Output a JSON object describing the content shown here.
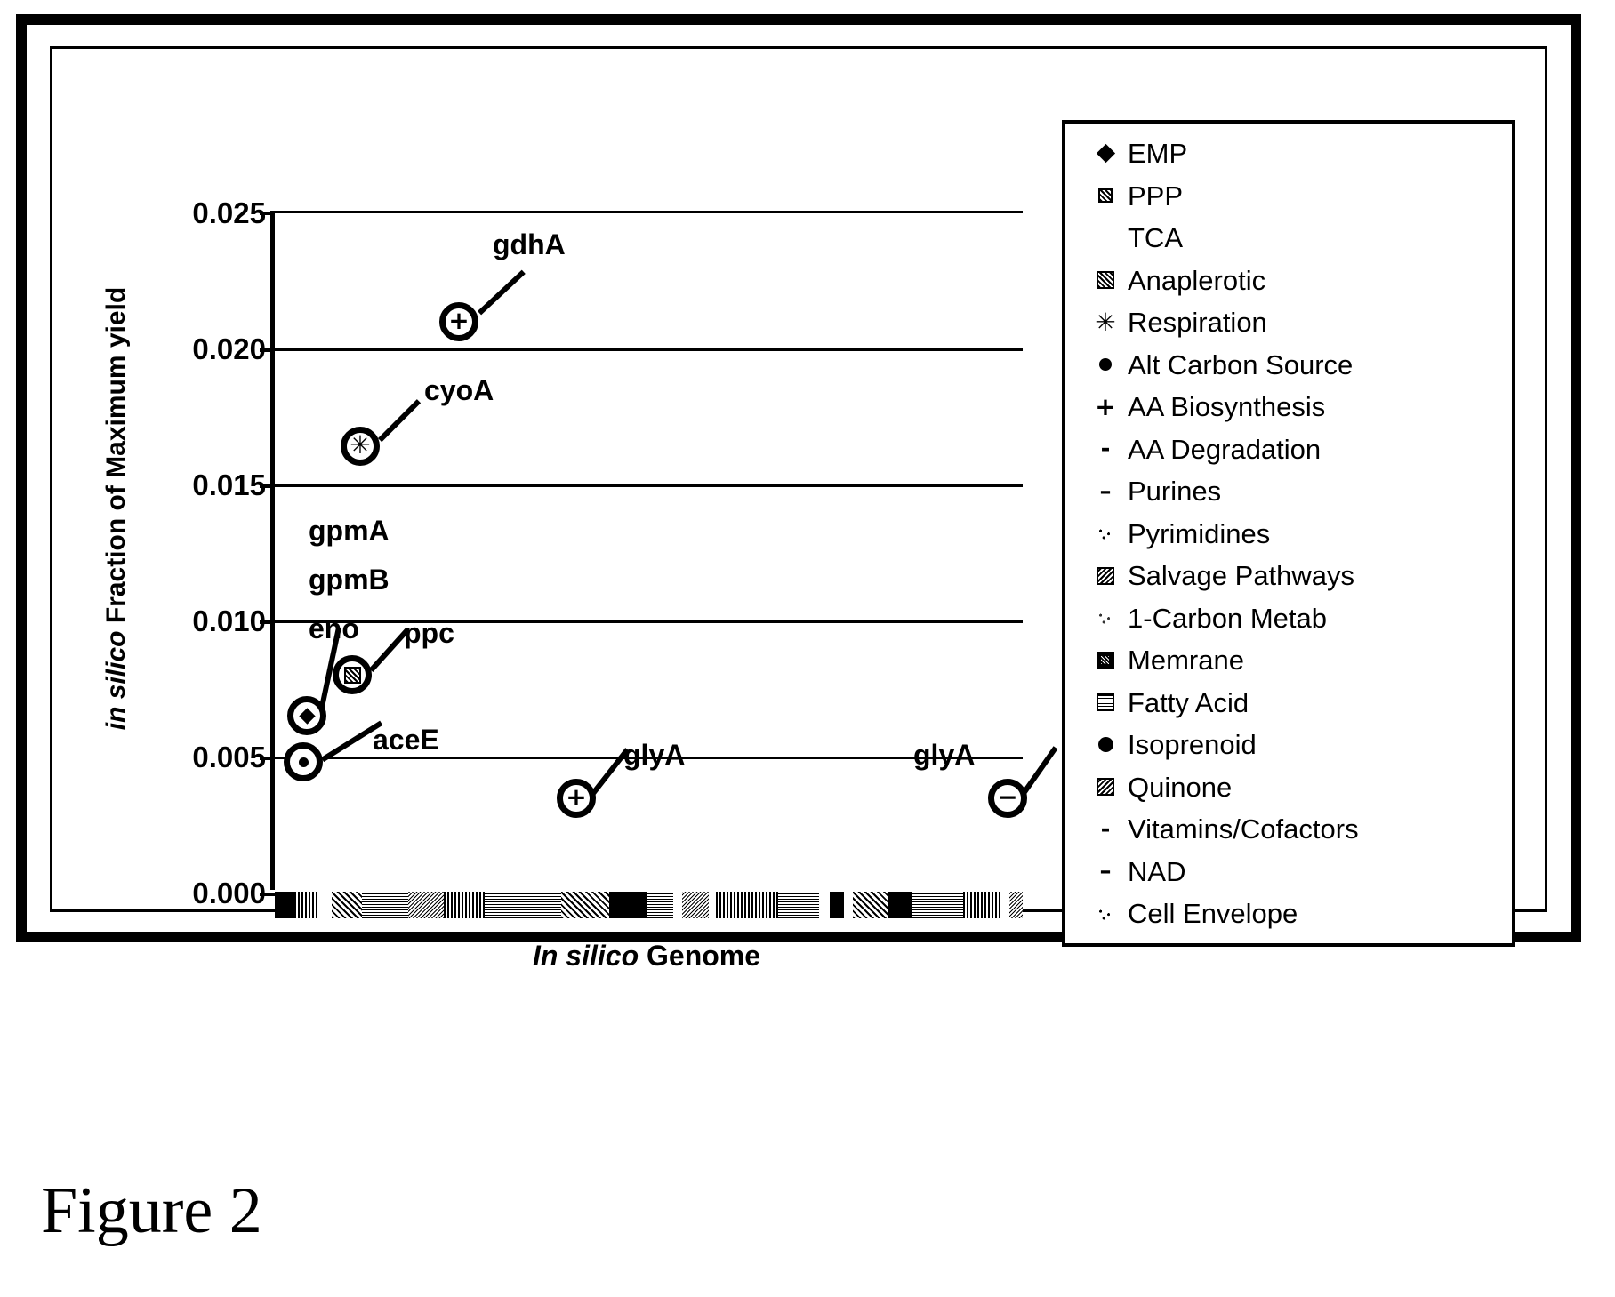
{
  "figure": {
    "caption": "Figure 2"
  },
  "chart_data": {
    "type": "scatter",
    "title": "",
    "xlabel_italic": "In silico",
    "xlabel_rest": " Genome",
    "ylabel_italic": "in silico",
    "ylabel_rest": " Fraction of Maximum yield",
    "ylim": [
      0.0,
      0.025
    ],
    "ytick_labels": [
      "0.025",
      "0.020",
      "0.015",
      "0.010",
      "0.005",
      "0.000"
    ],
    "ytick_values": [
      0.025,
      0.02,
      0.015,
      0.01,
      0.005,
      0.0
    ],
    "grid": "horizontal",
    "xaxis_note": "Genome position (unlabeled chromosomal map bar)",
    "points": [
      {
        "gene": "gdhA",
        "value": 0.021,
        "x_frac": 0.245,
        "category": "AA Biosynthesis",
        "marker": "plus"
      },
      {
        "gene": "cyoA",
        "value": 0.0164,
        "x_frac": 0.113,
        "category": "Respiration",
        "marker": "asterisk"
      },
      {
        "gene": "ppc",
        "value": 0.008,
        "x_frac": 0.102,
        "category": "Anaplerotic",
        "marker": "square-hatch"
      },
      {
        "gene": "gpmA gpmB eno",
        "value": 0.0065,
        "x_frac": 0.042,
        "category": "EMP",
        "marker": "diamond"
      },
      {
        "gene": "aceE",
        "value": 0.0048,
        "x_frac": 0.038,
        "category": "Alt Carbon Source",
        "marker": "dot"
      },
      {
        "gene": "glyA",
        "value": 0.0035,
        "x_frac": 0.4,
        "category": "AA Biosynthesis",
        "marker": "plus"
      },
      {
        "gene": "glyA",
        "value": 0.0035,
        "x_frac": 0.975,
        "category": "AA Degradation",
        "marker": "minus"
      }
    ],
    "annotations": [
      {
        "text": "gdhA"
      },
      {
        "text": "cyoA"
      },
      {
        "text": "gpmA"
      },
      {
        "text": "gpmB"
      },
      {
        "text": "eno"
      },
      {
        "text": "ppc"
      },
      {
        "text": "aceE"
      },
      {
        "text": "glyA"
      },
      {
        "text": "glyA"
      }
    ],
    "legend_position": "right",
    "legend": [
      {
        "label": "EMP",
        "key": "diamond"
      },
      {
        "label": "PPP",
        "key": "square-small-hatch"
      },
      {
        "label": "TCA",
        "key": "blank"
      },
      {
        "label": "Anaplerotic",
        "key": "square-hatch"
      },
      {
        "label": "Respiration",
        "key": "asterisk"
      },
      {
        "label": "Alt  Carbon Source",
        "key": "dot"
      },
      {
        "label": "AA Biosynthesis",
        "key": "plus"
      },
      {
        "label": "AA Degradation",
        "key": "hyphen"
      },
      {
        "label": "Purines",
        "key": "dash"
      },
      {
        "label": "Pyrimidines",
        "key": "sparse-dots"
      },
      {
        "label": "Salvage Pathways",
        "key": "square-dense"
      },
      {
        "label": "1-Carbon Metab",
        "key": "sparse-dots-light"
      },
      {
        "label": "Memrane",
        "key": "square-dark"
      },
      {
        "label": "Fatty Acid",
        "key": "square-grid"
      },
      {
        "label": "Isoprenoid",
        "key": "dot-large"
      },
      {
        "label": "Quinone",
        "key": "square-dense2"
      },
      {
        "label": "Vitamins/Cofactors",
        "key": "hyphen"
      },
      {
        "label": "NAD",
        "key": "dash"
      },
      {
        "label": "Cell Envelope",
        "key": "sparse-dots"
      }
    ]
  }
}
